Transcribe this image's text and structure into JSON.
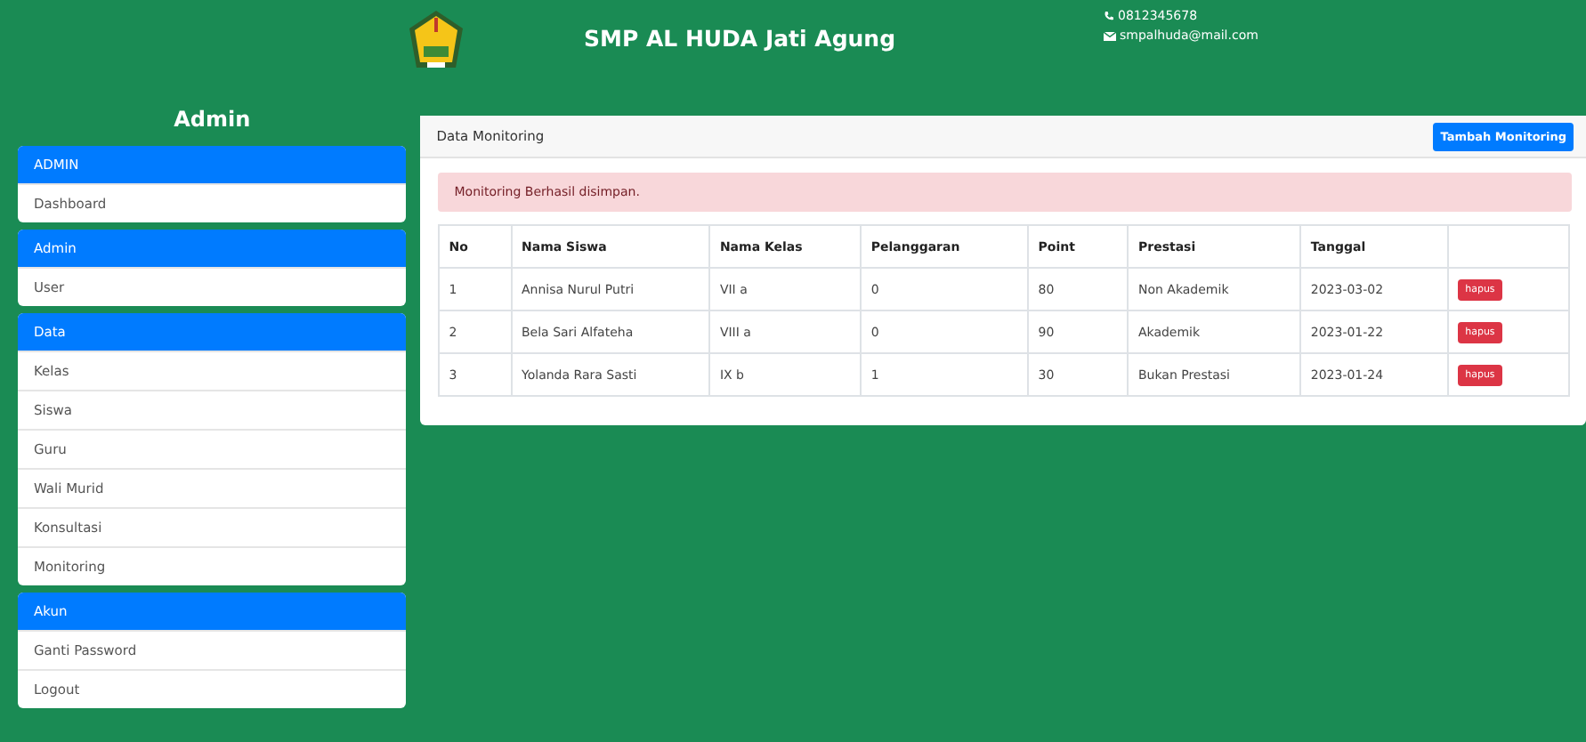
{
  "header": {
    "title": "SMP AL HUDA Jati Agung",
    "phone": "0812345678",
    "email": "smpalhuda@mail.com"
  },
  "sidebar": {
    "title": "Admin",
    "groups": [
      {
        "heading": "ADMIN",
        "items": [
          "Dashboard"
        ]
      },
      {
        "heading": "Admin",
        "items": [
          "User"
        ]
      },
      {
        "heading": "Data",
        "items": [
          "Kelas",
          "Siswa",
          "Guru",
          "Wali Murid",
          "Konsultasi",
          "Monitoring"
        ]
      },
      {
        "heading": "Akun",
        "items": [
          "Ganti Password",
          "Logout"
        ]
      }
    ]
  },
  "panel": {
    "title": "Data Monitoring",
    "add_button": "Tambah Monitoring",
    "alert": "Monitoring Berhasil disimpan.",
    "table": {
      "columns": [
        "No",
        "Nama Siswa",
        "Nama Kelas",
        "Pelanggaran",
        "Point",
        "Prestasi",
        "Tanggal"
      ],
      "rows": [
        {
          "cells": [
            "1",
            "Annisa Nurul Putri",
            "VII a",
            "0",
            "80",
            "Non Akademik",
            "2023-03-02"
          ],
          "action": "hapus"
        },
        {
          "cells": [
            "2",
            "Bela Sari Alfateha",
            "VIII a",
            "0",
            "90",
            "Akademik",
            "2023-01-22"
          ],
          "action": "hapus"
        },
        {
          "cells": [
            "3",
            "Yolanda Rara Sasti",
            "IX b",
            "1",
            "30",
            "Bukan Prestasi",
            "2023-01-24"
          ],
          "action": "hapus"
        }
      ]
    }
  }
}
